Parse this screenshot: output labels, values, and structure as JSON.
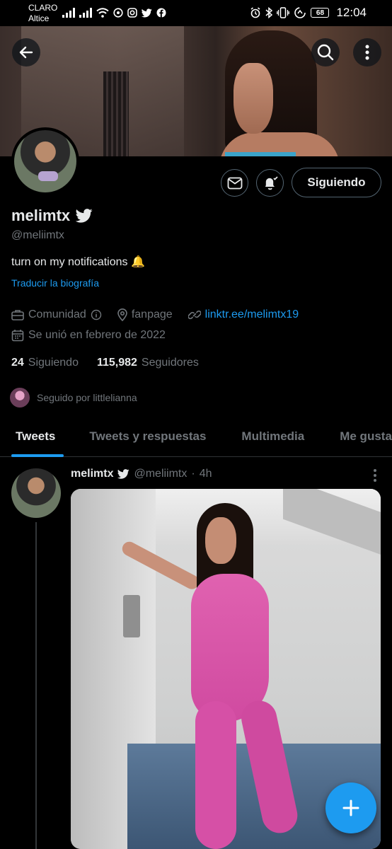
{
  "status_bar": {
    "carrier": "CLARO",
    "carrier2": "Altice",
    "battery": "68",
    "time": "12:04"
  },
  "profile": {
    "name": "melimtx",
    "handle": "@meliimtx",
    "bio": "turn on my notifications 🔔",
    "translate_label": "Traducir la biografía",
    "category": "Comunidad",
    "location": "fanpage",
    "website": "linktr.ee/melimtx19",
    "joined": "Se unió en febrero de 2022",
    "following_count": "24",
    "following_label": "Siguiendo",
    "followers_count": "115,982",
    "followers_label": "Seguidores",
    "followed_by": "Seguido por littlelianna",
    "follow_button_label": "Siguiendo"
  },
  "tabs": [
    {
      "label": "Tweets",
      "active": true
    },
    {
      "label": "Tweets y respuestas",
      "active": false
    },
    {
      "label": "Multimedia",
      "active": false
    },
    {
      "label": "Me gusta",
      "active": false
    }
  ],
  "tweet": {
    "author_name": "melimtx",
    "author_handle": "@meliimtx",
    "separator": "·",
    "time": "4h"
  },
  "colors": {
    "accent": "#1d9bf0",
    "background": "#000000",
    "secondary_text": "#71767b"
  },
  "icons": [
    "back-arrow-icon",
    "search-icon",
    "more-vertical-icon",
    "mail-icon",
    "bell-icon",
    "verified-badge-icon",
    "category-icon",
    "info-icon",
    "location-icon",
    "link-icon",
    "calendar-icon",
    "compose-plus-icon"
  ]
}
